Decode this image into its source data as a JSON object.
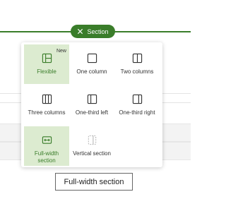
{
  "section_pill": {
    "label": "Section",
    "icon": "close-icon"
  },
  "layout_options": [
    {
      "label": "Flexible",
      "icon": "flexible-layout-icon",
      "badge": "New",
      "selected": true
    },
    {
      "label": "One column",
      "icon": "one-column-icon",
      "selected": false
    },
    {
      "label": "Two columns",
      "icon": "two-columns-icon",
      "selected": false
    },
    {
      "label": "Three columns",
      "icon": "three-columns-icon",
      "selected": false
    },
    {
      "label": "One-third left",
      "icon": "one-third-left-icon",
      "selected": false
    },
    {
      "label": "One-third right",
      "icon": "one-third-right-icon",
      "selected": false
    },
    {
      "label": "Full-width section",
      "icon": "full-width-section-icon",
      "selected": true
    },
    {
      "label": "Vertical section",
      "icon": "vertical-section-icon",
      "selected": false,
      "disabled": true
    }
  ],
  "tooltip": {
    "text": "Full-width section"
  },
  "colors": {
    "accent": "#3a7d2a",
    "selected_bg": "#dcebd0"
  }
}
